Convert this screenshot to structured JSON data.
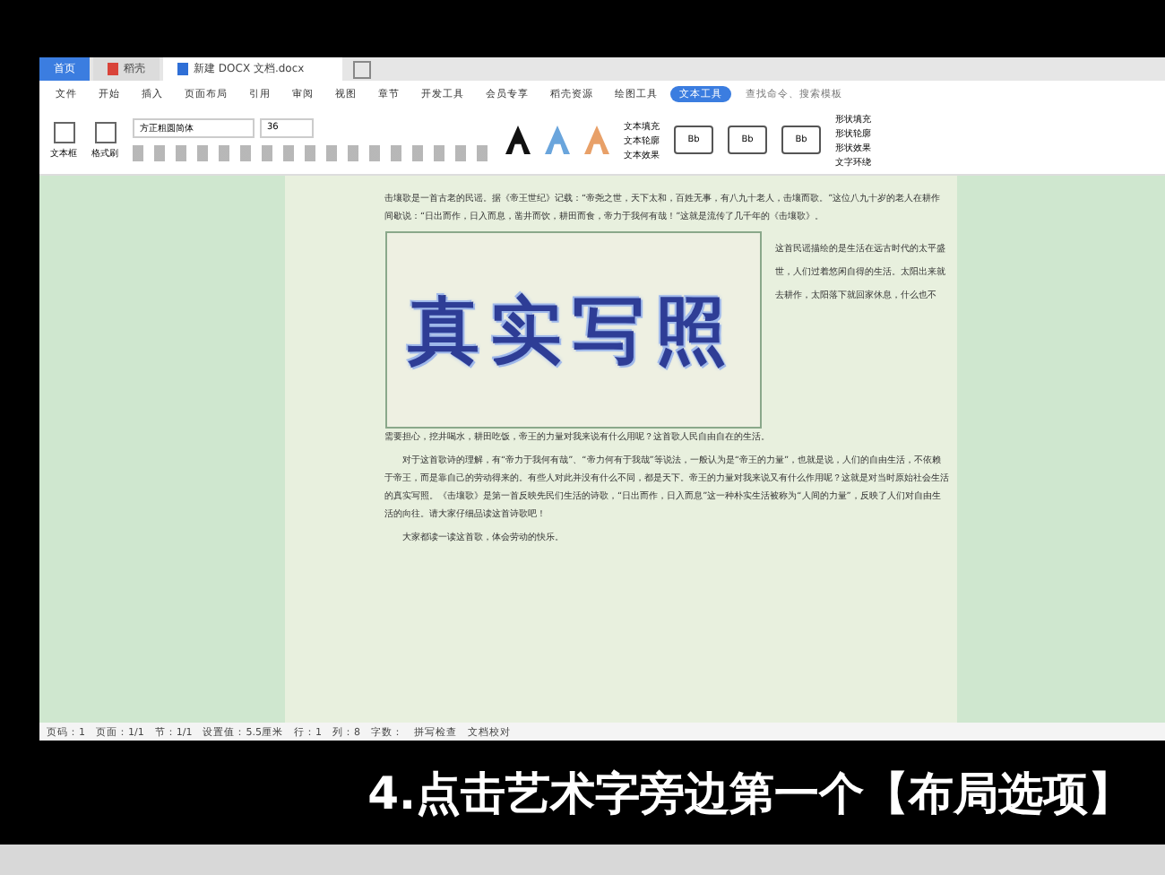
{
  "window_tabs": [
    {
      "label": "首页",
      "selected": false,
      "kind": "home"
    },
    {
      "label": "稻壳",
      "selected": false,
      "kind": "app"
    },
    {
      "label": "新建 DOCX 文档.docx",
      "selected": true,
      "kind": "doc"
    }
  ],
  "menu": [
    {
      "label": "文件",
      "selected": false
    },
    {
      "label": "开始",
      "selected": false
    },
    {
      "label": "插入",
      "selected": false
    },
    {
      "label": "页面布局",
      "selected": false
    },
    {
      "label": "引用",
      "selected": false
    },
    {
      "label": "审阅",
      "selected": false
    },
    {
      "label": "视图",
      "selected": false
    },
    {
      "label": "章节",
      "selected": false
    },
    {
      "label": "开发工具",
      "selected": false
    },
    {
      "label": "会员专享",
      "selected": false
    },
    {
      "label": "稻壳资源",
      "selected": false
    },
    {
      "label": "绘图工具",
      "selected": false
    },
    {
      "label": "文本工具",
      "selected": true
    }
  ],
  "search": {
    "placeholder": "查找命令、搜索模板"
  },
  "ribbon": {
    "left_buttons": [
      "文本框",
      "格式刷"
    ],
    "font_name": "方正粗圆简体",
    "font_size": "36",
    "style_buttons": [
      "文本填充",
      "文本轮廓",
      "文本效果"
    ],
    "presets": [
      "Bb",
      "Bb",
      "Bb"
    ],
    "right_buttons": [
      "形状填充",
      "形状轮廓",
      "形状效果",
      "文字环绕"
    ]
  },
  "document": {
    "paragraph_top": "击壤歌是一首古老的民谣。据《帝王世纪》记载：“帝尧之世，天下太和，百姓无事，有八九十老人，击壤而歌。”这位八九十岁的老人在耕作间歇说：“日出而作，日入而息，凿井而饮，耕田而食，帝力于我何有哉！”这就是流传了几千年的《击壤歌》。",
    "wordart": "真实写照",
    "side_text": "这首民谣描绘的是生活在远古时代的太平盛世，人们过着悠闲自得的生活。太阳出来就去耕作，太阳落下就回家休息，什么也不",
    "paragraph_cont": "需要担心，挖井喝水，耕田吃饭，帝王的力量对我来说有什么用呢？这首歌人民自由自在的生活。",
    "paragraph_2": "对于这首歌诗的理解，有“帝力于我何有哉”、“帝力何有于我哉”等说法，一般认为是“帝王的力量”，也就是说，人们的自由生活，不依赖于帝王，而是靠自己的劳动得来的。有些人对此并没有什么不同，都是天下。帝王的力量对我来说又有什么作用呢？这就是对当时原始社会生活的真实写照。《击壤歌》是第一首反映先民们生活的诗歌，“日出而作，日入而息”这一种朴实生活被称为“人间的力量”，反映了人们对自由生活的向往。请大家仔细品读这首诗歌吧！",
    "paragraph_3": "大家都读一读这首歌，体会劳动的快乐。"
  },
  "status_bar": [
    "页码：1",
    "页面：1/1",
    "节：1/1",
    "设置值：5.5厘米",
    "行：1",
    "列：8",
    "字数：",
    "拼写检查",
    "文档校对"
  ],
  "caption": "4.点击艺术字旁边第一个【布局选项】"
}
